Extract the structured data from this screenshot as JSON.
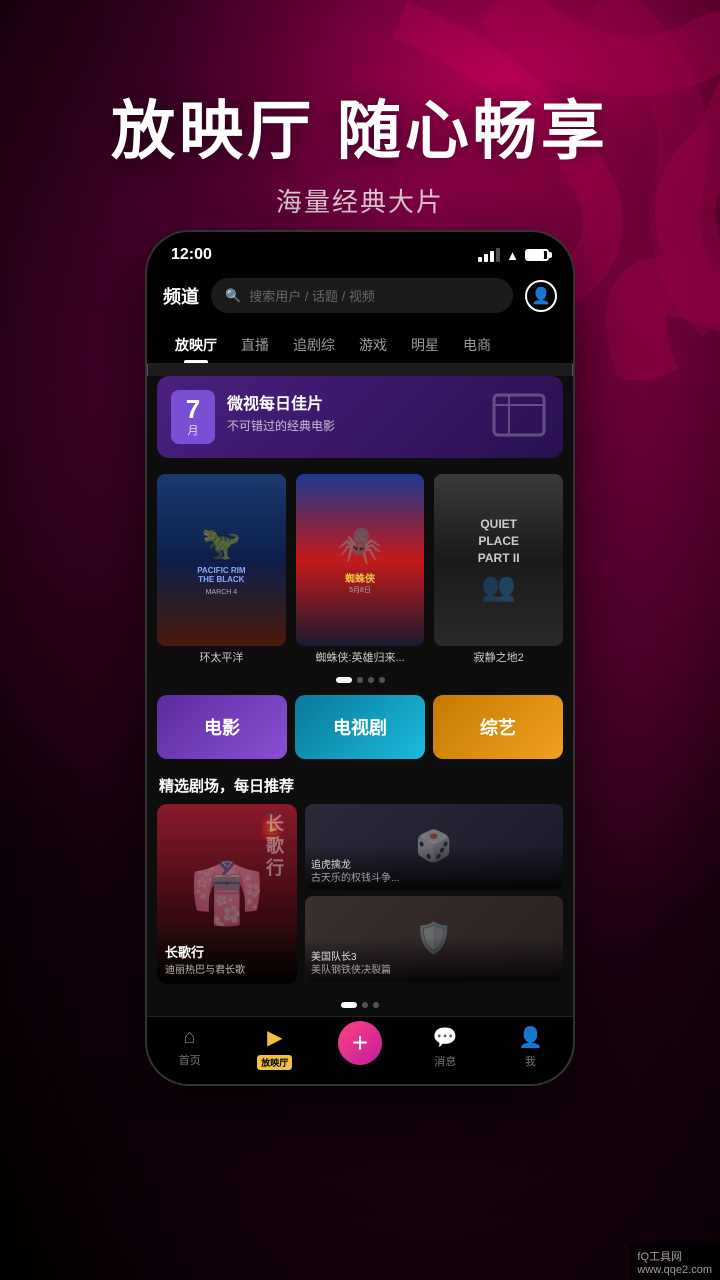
{
  "background": {
    "color": "#1a0010"
  },
  "hero": {
    "title": "放映厅 随心畅享",
    "subtitle": "海量经典大片"
  },
  "phone": {
    "status_bar": {
      "time": "12:00"
    },
    "header": {
      "logo": "频道",
      "search_placeholder": "搜索用户 / 话题 / 视频"
    },
    "nav_tabs": [
      {
        "label": "放映厅",
        "active": true
      },
      {
        "label": "直播",
        "active": false
      },
      {
        "label": "追剧综",
        "active": false
      },
      {
        "label": "游戏",
        "active": false
      },
      {
        "label": "明星",
        "active": false
      },
      {
        "label": "电商",
        "active": false
      }
    ],
    "featured": {
      "date_num": "7",
      "date_unit": "月",
      "title": "微视每日佳片",
      "subtitle": "不可错过的经典电影"
    },
    "movies": [
      {
        "title": "环太平洋",
        "subtitle": "PACIFIC RIM THE BLACK",
        "date": "MARCH 4"
      },
      {
        "title": "蜘蛛侠:英雄归来...",
        "subtitle": "蜘蛛侠",
        "date": "5月8日"
      },
      {
        "title": "寂静之地2",
        "subtitle": "",
        "date": ""
      }
    ],
    "categories": [
      {
        "label": "电影",
        "type": "movie"
      },
      {
        "label": "电视剧",
        "type": "tv"
      },
      {
        "label": "综艺",
        "type": "variety"
      }
    ],
    "section_title": "精选剧场，每日推荐",
    "dramas": [
      {
        "main_title": "长歌行",
        "main_sub": "迪丽热巴与君长歌",
        "items": [
          {
            "title": "追虎擒龙\n古天乐的权钱斗争..."
          },
          {
            "title": "美国队长3\n美队钢铁侠决裂篇"
          }
        ]
      }
    ],
    "bottom_nav": [
      {
        "label": "首页",
        "active": false
      },
      {
        "label": "放映厅",
        "active": true,
        "badge": "放映厅"
      },
      {
        "label": "+",
        "active": false,
        "is_plus": true
      },
      {
        "label": "消息",
        "active": false
      },
      {
        "label": "我",
        "active": false
      }
    ]
  },
  "watermark": {
    "line1": "fQ工具网",
    "line2": "www.qqe2.com"
  }
}
